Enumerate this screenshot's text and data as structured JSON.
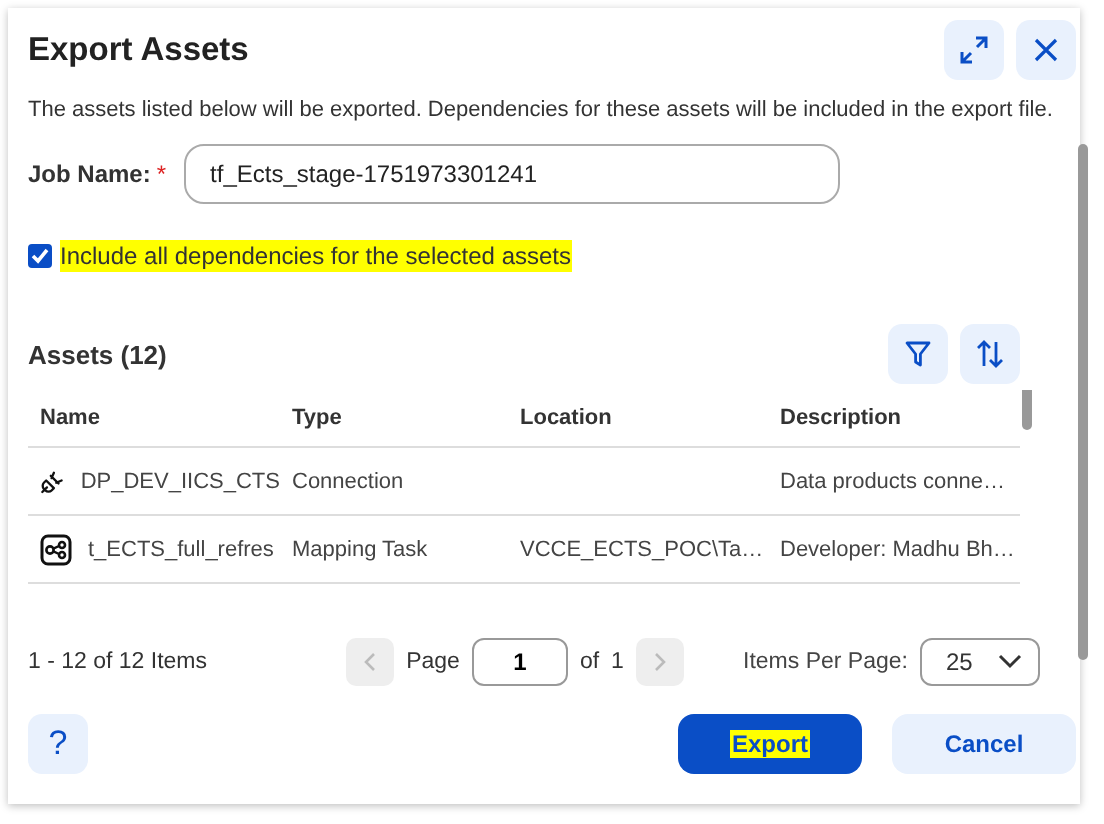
{
  "dialog": {
    "title": "Export Assets",
    "description": "The assets listed below will be exported. Dependencies for these assets will be included in the export file."
  },
  "job_name": {
    "label": "Job Name:",
    "required_mark": "*",
    "value": "tf_Ects_stage-1751973301241"
  },
  "include_dependencies": {
    "label": "Include all dependencies for the selected assets",
    "checked": true,
    "highlighted": true
  },
  "assets": {
    "title": "Assets (12)",
    "columns": [
      "Name",
      "Type",
      "Location",
      "Description"
    ],
    "rows": [
      {
        "kind": "connection",
        "name": "DP_DEV_IICS_CTS",
        "type": "Connection",
        "location": "",
        "description": "Data products conne…"
      },
      {
        "kind": "mapping-task",
        "name": "t_ECTS_full_refres",
        "type": "Mapping Task",
        "location": "VCCE_ECTS_POC\\Ta…",
        "description": "Developer: Madhu Bh…"
      }
    ]
  },
  "pagination": {
    "summary": "1 - 12 of 12 Items",
    "page_label": "Page",
    "page": "1",
    "of_label": "of",
    "total_pages": "1",
    "prev_disabled": true,
    "next_disabled": true,
    "per_page_label": "Items Per Page:",
    "per_page": "25"
  },
  "footer": {
    "help": "?",
    "buttons": [
      {
        "label": "Export",
        "kind": "primary",
        "highlighted": true
      },
      {
        "label": "Cancel",
        "kind": "secondary",
        "highlighted": false
      }
    ]
  }
}
